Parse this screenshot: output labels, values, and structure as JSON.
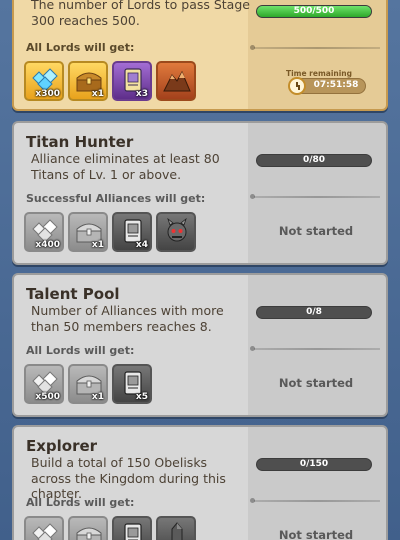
{
  "cards": [
    {
      "title": "",
      "description": "The number of Lords to pass Stage 300 reaches 500.",
      "reward_label": "All Lords will get:",
      "progress_text": "500/500",
      "progress": 1.0,
      "timer_label": "Time remaining",
      "timer_value": "07:51:58",
      "rewards": [
        {
          "icon": "diamonds-icon",
          "qty": "x300"
        },
        {
          "icon": "gold-chest-icon",
          "qty": "x1"
        },
        {
          "icon": "purple-scroll-icon",
          "qty": "x3"
        },
        {
          "icon": "orange-mountain-icon",
          "qty": ""
        }
      ]
    },
    {
      "title": "Titan Hunter",
      "description": "Alliance eliminates at least 80 Titans of Lv. 1 or above.",
      "reward_label": "Successful Alliances will get:",
      "progress_text": "0/80",
      "progress": 0,
      "status": "Not started",
      "rewards": [
        {
          "icon": "diamonds-icon",
          "qty": "x400"
        },
        {
          "icon": "chest-icon",
          "qty": "x1"
        },
        {
          "icon": "scroll-icon",
          "qty": "x4"
        },
        {
          "icon": "titan-icon",
          "qty": ""
        }
      ]
    },
    {
      "title": "Talent Pool",
      "description": "Number of Alliances with more than 50 members reaches 8.",
      "reward_label": "All Lords will get:",
      "progress_text": "0/8",
      "progress": 0,
      "status": "Not started",
      "rewards": [
        {
          "icon": "diamonds-icon",
          "qty": "x500"
        },
        {
          "icon": "chest-icon",
          "qty": "x1"
        },
        {
          "icon": "scroll-icon",
          "qty": "x5"
        }
      ]
    },
    {
      "title": "Explorer",
      "description": "Build a total of 150 Obelisks across the Kingdom during this chapter.",
      "reward_label": "All Lords will get:",
      "progress_text": "0/150",
      "progress": 0,
      "status": "Not started",
      "rewards": [
        {
          "icon": "diamonds-icon",
          "qty": ""
        },
        {
          "icon": "chest-icon",
          "qty": ""
        },
        {
          "icon": "scroll-icon",
          "qty": ""
        },
        {
          "icon": "obelisk-icon",
          "qty": ""
        }
      ]
    }
  ]
}
